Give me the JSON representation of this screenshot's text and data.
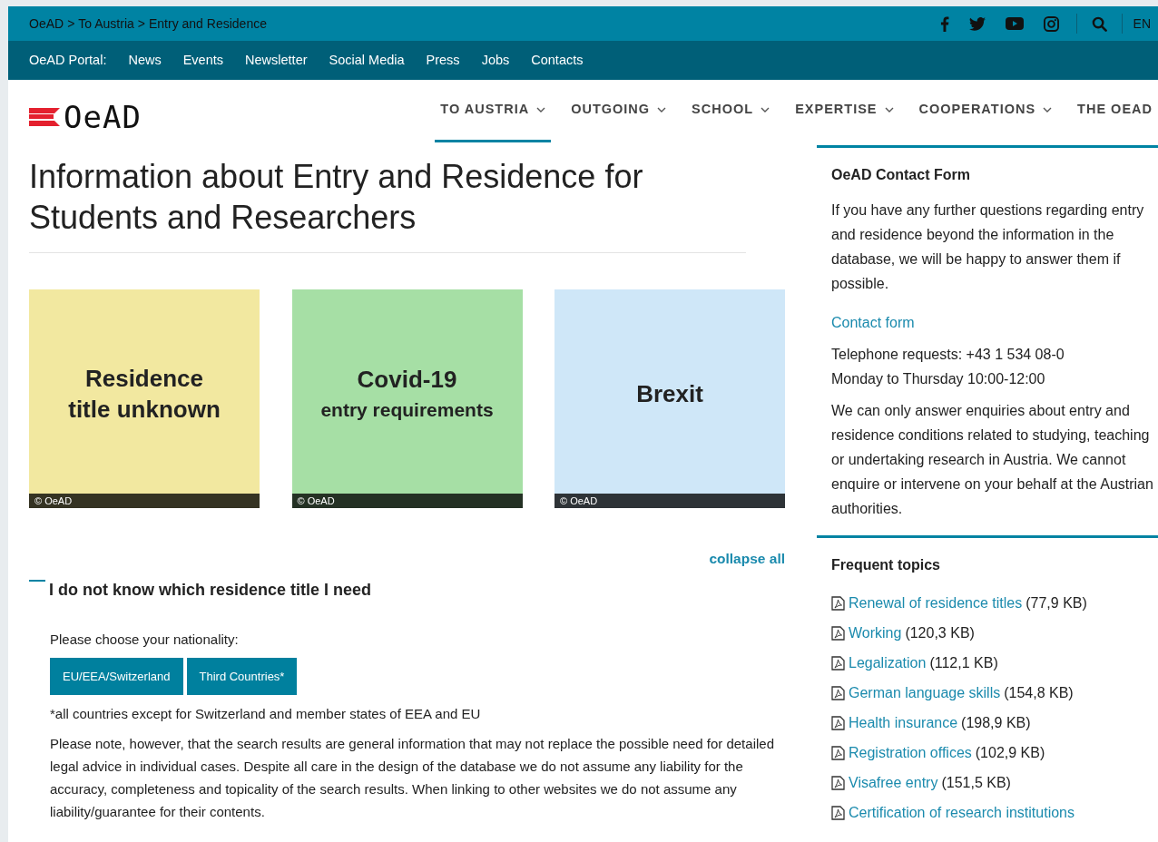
{
  "breadcrumb": {
    "items": [
      "OeAD",
      "To Austria",
      "Entry and Residence"
    ],
    "separator": ">"
  },
  "language": "EN",
  "portal": {
    "label": "OeAD Portal:",
    "links": [
      "News",
      "Events",
      "Newsletter",
      "Social Media",
      "Press",
      "Jobs",
      "Contacts"
    ]
  },
  "logo": {
    "text": "OeAD"
  },
  "nav": [
    {
      "label": "TO AUSTRIA",
      "selected": true,
      "dropdown": true
    },
    {
      "label": "OUTGOING",
      "selected": false,
      "dropdown": true
    },
    {
      "label": "SCHOOL",
      "selected": false,
      "dropdown": true
    },
    {
      "label": "EXPERTISE",
      "selected": false,
      "dropdown": true
    },
    {
      "label": "COOPERATIONS",
      "selected": false,
      "dropdown": true
    },
    {
      "label": "THE OEAD",
      "selected": false,
      "dropdown": false
    }
  ],
  "heading": "Information about Entry and Residence for Students and Researchers",
  "tiles": [
    {
      "title": "Residence",
      "subtitle": "title unknown",
      "color": "#f2e8a0",
      "credit": "© OeAD"
    },
    {
      "title": "Covid-19",
      "subtitle": "entry requirements",
      "color": "#a6dfa5",
      "credit": "© OeAD"
    },
    {
      "title": "Brexit",
      "color": "#cfe7f8",
      "credit": "© OeAD"
    }
  ],
  "collapse_all": "collapse all",
  "accordion": {
    "title": "I do not know which residence title I need",
    "expanded": true,
    "prompt": "Please choose your nationality:",
    "buttons": [
      "EU/EEA/Switzerland",
      "Third Countries*"
    ],
    "footnote": "*all countries except for Switzerland and member states of EEA and EU",
    "disclaimer": "Please note, however, that the search results are general information that may not replace the possible need for detailed legal advice in individual cases. Despite all care in the design of the database we do not assume any liability for the accuracy, completeness and topicality of the search results. When linking to other websites we do not assume any liability/guarantee for their contents."
  },
  "contact": {
    "title": "OeAD Contact Form",
    "intro": "If you have any further questions regarding entry and residence beyond the information in the database, we will be happy to answer them if possible.",
    "link": "Contact form",
    "phone": "Telephone requests: +43 1 534 08-0",
    "hours": "Monday to Thursday 10:00-12:00",
    "note": "We can only answer enquiries about entry and residence conditions related to studying, teaching or undertaking research in Austria. We cannot enquire or intervene on your behalf at the Austrian authorities."
  },
  "topics": {
    "title": "Frequent topics",
    "items": [
      {
        "label": "Renewal of residence titles",
        "size": "(77,9 KB)"
      },
      {
        "label": "Working",
        "size": "(120,3 KB)"
      },
      {
        "label": "Legalization",
        "size": "(112,1 KB)"
      },
      {
        "label": "German language skills",
        "size": "(154,8 KB)"
      },
      {
        "label": "Health insurance",
        "size": "(198,9 KB)"
      },
      {
        "label": "Registration offices",
        "size": "(102,9 KB)"
      },
      {
        "label": "Visafree entry",
        "size": "(151,5 KB)"
      },
      {
        "label": "Certification of research institutions"
      }
    ]
  }
}
